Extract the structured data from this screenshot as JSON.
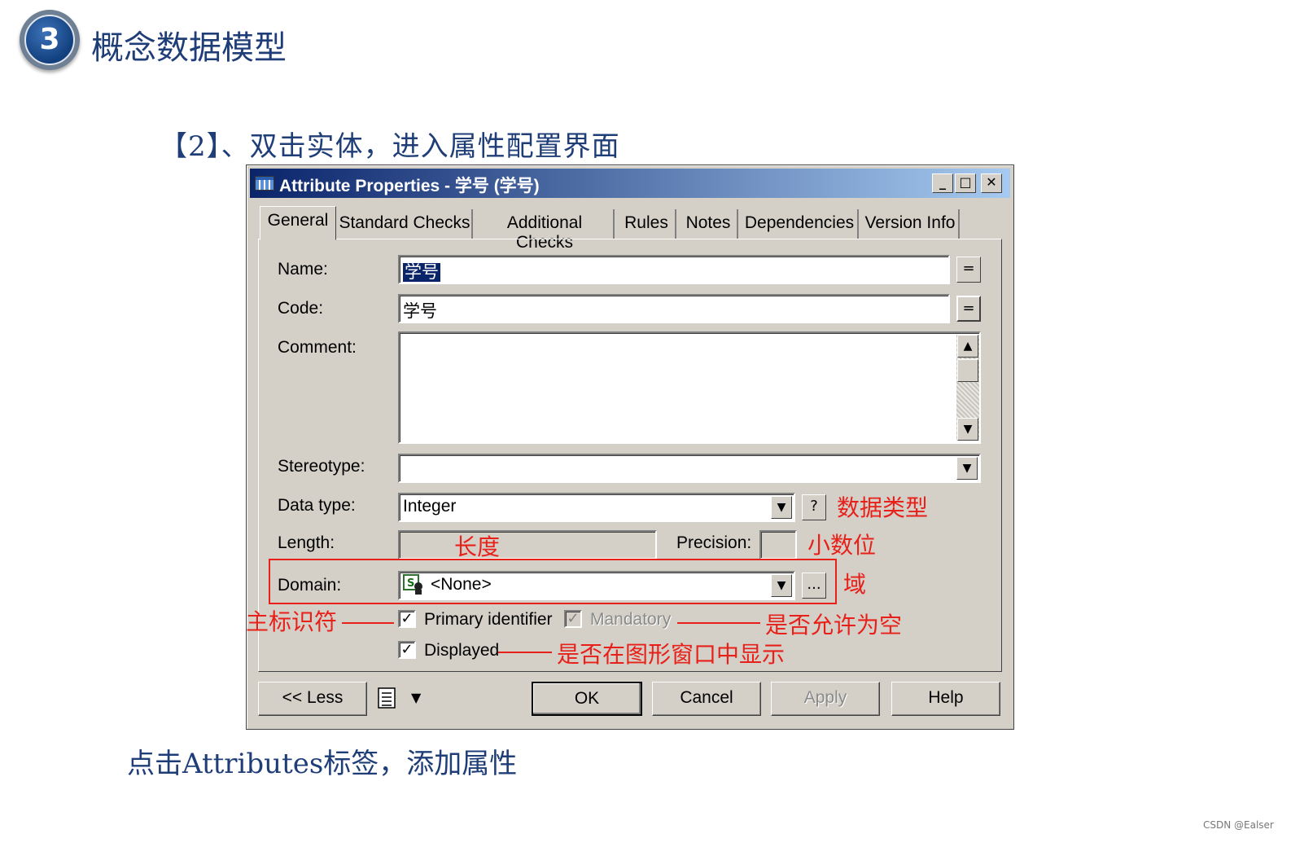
{
  "header": {
    "badge_number": "3",
    "title": "概念数据模型"
  },
  "subheading": "【2】、双击实体，进入属性配置界面",
  "bottom_note": "点击Attributes标签，添加属性",
  "credit": "CSDN @Ealser",
  "dialog": {
    "title": "Attribute Properties - 学号 (学号)",
    "window_buttons": {
      "minimize": "_",
      "maximize": "□",
      "close": "✕"
    },
    "tabs": [
      {
        "label": "General",
        "active": true
      },
      {
        "label": "Standard Checks"
      },
      {
        "label": "Additional Checks"
      },
      {
        "label": "Rules"
      },
      {
        "label": "Notes"
      },
      {
        "label": "Dependencies"
      },
      {
        "label": "Version Info"
      }
    ],
    "fields": {
      "name_label": "Name:",
      "name_value": "学号",
      "code_label": "Code:",
      "code_value": "学号",
      "comment_label": "Comment:",
      "comment_value": "",
      "stereotype_label": "Stereotype:",
      "stereotype_value": "",
      "data_type_label": "Data type:",
      "data_type_value": "Integer",
      "length_label": "Length:",
      "length_value": "",
      "precision_label": "Precision:",
      "precision_value": "",
      "domain_label": "Domain:",
      "domain_value": "<None>"
    },
    "small_buttons": {
      "equals": "=",
      "help": "?",
      "ellipsis": "..."
    },
    "checkboxes": {
      "primary_identifier": {
        "label": "Primary identifier",
        "checked": true
      },
      "mandatory": {
        "label": "Mandatory",
        "checked": true,
        "disabled": true
      },
      "displayed": {
        "label": "Displayed",
        "checked": true
      }
    },
    "buttons": {
      "less": "<< Less",
      "ok": "OK",
      "cancel": "Cancel",
      "apply": "Apply",
      "help": "Help"
    }
  },
  "annotations": {
    "data_type": "数据类型",
    "length": "长度",
    "precision": "小数位",
    "domain": "域",
    "primary_identifier": "主标识符",
    "mandatory": "是否允许为空",
    "displayed": "是否在图形窗口中显示"
  },
  "colors": {
    "heading": "#1f3e78",
    "annotation": "#e8201a",
    "dialog_face": "#d4d0c8",
    "titlebar_start": "#0a246a",
    "titlebar_end": "#a6caf0"
  },
  "icons": [
    "grid-icon",
    "domain-icon",
    "list-icon",
    "dropdown-arrow-icon",
    "checkmark-icon"
  ]
}
